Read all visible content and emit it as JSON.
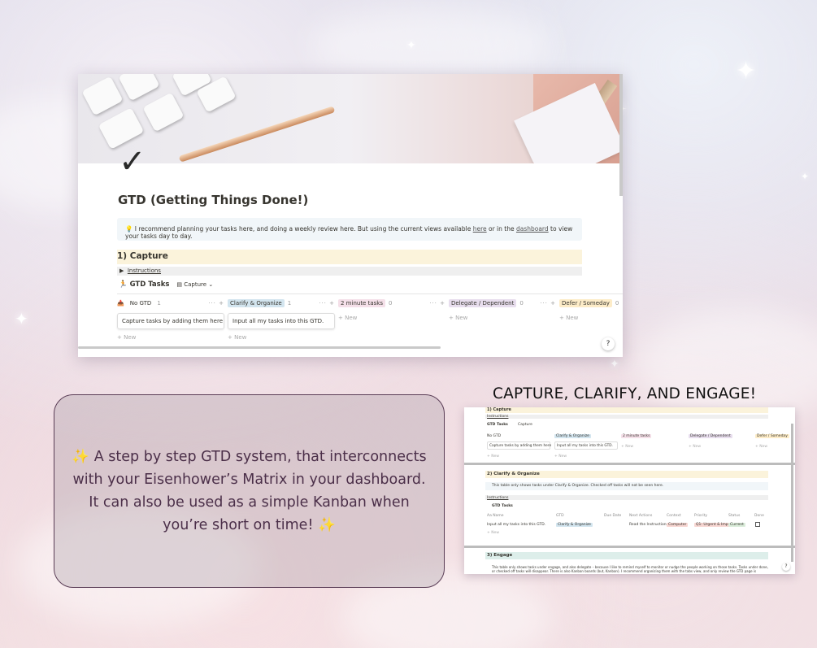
{
  "main_screenshot": {
    "page_title": "GTD (Getting Things Done!)",
    "callout_icon": "lightbulb-icon",
    "callout_text_1": "I recommend planning your tasks here, and doing a weekly review here. But using the current views available ",
    "callout_link_here": "here",
    "callout_text_2": " or in the ",
    "callout_link_dashboard": "dashboard",
    "callout_text_3": " to view your tasks day to day.",
    "section_heading": "1) Capture",
    "toggle_label": "Instructions",
    "database_title": "GTD Tasks",
    "view_name": "Capture",
    "columns": [
      {
        "label": "No GTD",
        "count": "1",
        "color": "#ffffff",
        "card": "Capture tasks by adding them here",
        "new": "+ New"
      },
      {
        "label": "Clarify & Organize",
        "count": "1",
        "color": "#d3e5ef",
        "card": "Input all my tasks into this GTD.",
        "new": "+ New"
      },
      {
        "label": "2 minute tasks",
        "count": "0",
        "color": "#f5e0e9",
        "card": "",
        "new": "+ New"
      },
      {
        "label": "Delegate / Dependent",
        "count": "0",
        "color": "#e8deee",
        "card": "",
        "new": "+ New"
      },
      {
        "label": "Defer / Someday",
        "count": "0",
        "color": "#fdecc8",
        "card": "",
        "new": "+ New"
      }
    ],
    "col_actions": "··· +",
    "help_label": "?"
  },
  "description": "✨ A step by step GTD system, that interconnects with your Eisenhower’s Matrix in your dashboard. It can also be used as a simple Kanban when you’re short on time! ✨",
  "heading": "CAPTURE, CLARIFY, AND ENGAGE!",
  "second_screenshot": {
    "top_heading": "1) Capture",
    "toggle_label": "Instructions",
    "db_title": "GTD Tasks",
    "view_capture": "Capture",
    "columns": [
      "No GTD",
      "Clarify & Organize",
      "2 minute tasks",
      "Delegate / Dependent",
      "Defer / Someday"
    ],
    "cards": [
      "Capture tasks by adding them here",
      "Input all my tasks into this GTD."
    ],
    "new_label": "+ New",
    "section2_heading": "2) Clarify & Organize",
    "section2_callout": "This table only shows tasks under Clarify & Organize. Checked off tasks will not be seen here.",
    "section2_toggle": "Instructions",
    "section2_db": "GTD Tasks",
    "table_headers": [
      "Aa Name",
      "GTD",
      "Due Date",
      "Next Actions",
      "Context",
      "Priority",
      "Status",
      "Done"
    ],
    "table_row": {
      "name": "Input all my tasks into this GTD.",
      "gtd": "Clarify & Organize",
      "next_actions": "Read the Instructions.",
      "context": "Computer",
      "priority": "Q1: Urgent & Import",
      "status": "Current"
    },
    "section3_heading": "3) Engage",
    "section3_callout_1": "This table only shows tasks under engage, and also delegate – because I like to remind myself to monitor or nudge the people working on those tasks. Tasks under done,",
    "section3_callout_2": "or checked off tasks will disappear. There is also Kanban boards (but, Kanban). I recommend organizing them with the tabs view, and only review the GTD page is",
    "help_label": "?"
  }
}
